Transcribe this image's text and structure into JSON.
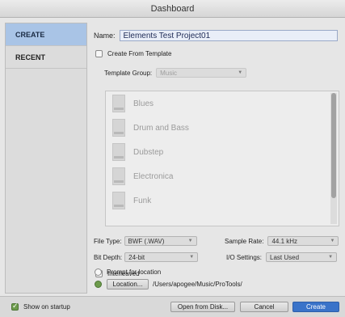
{
  "window": {
    "title": "Dashboard"
  },
  "sidebar": {
    "items": [
      {
        "label": "CREATE"
      },
      {
        "label": "RECENT"
      }
    ]
  },
  "form": {
    "name_label": "Name:",
    "name_value": "Elements Test Project01",
    "create_from_template_label": "Create From Template",
    "template_group_label": "Template Group:",
    "template_group_value": "Music",
    "templates": [
      {
        "name": "Blues"
      },
      {
        "name": "Drum and Bass"
      },
      {
        "name": "Dubstep"
      },
      {
        "name": "Electronica"
      },
      {
        "name": "Funk"
      }
    ],
    "file_type_label": "File Type:",
    "file_type_value": "BWF (.WAV)",
    "sample_rate_label": "Sample Rate:",
    "sample_rate_value": "44.1 kHz",
    "bit_depth_label": "Bit Depth:",
    "bit_depth_value": "24-bit",
    "io_settings_label": "I/O Settings:",
    "io_settings_value": "Last Used",
    "interleaved_label": "Interleaved",
    "prompt_location_label": "Prompt for location",
    "location_button_label": "Location...",
    "location_path": "/Users/apogee/Music/ProTools/"
  },
  "footer": {
    "show_on_startup_label": "Show on startup",
    "open_from_disk_label": "Open from Disk...",
    "cancel_label": "Cancel",
    "create_label": "Create"
  },
  "colors": {
    "accent": "#3a73c9",
    "sidebar_active": "#a9c4e6",
    "checkbox_green": "#6d9b4c"
  }
}
